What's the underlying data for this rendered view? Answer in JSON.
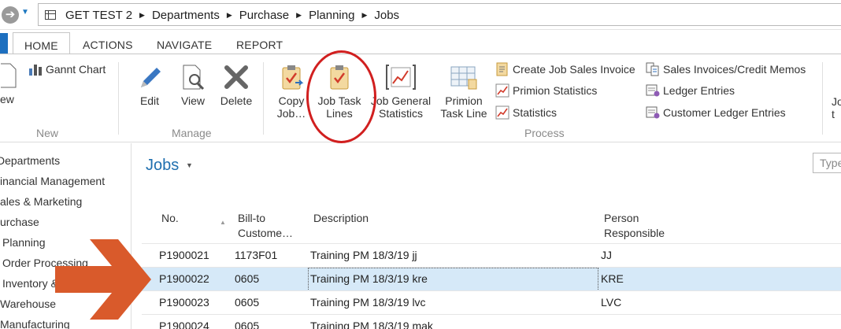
{
  "breadcrumb": [
    "GET TEST 2",
    "Departments",
    "Purchase",
    "Planning",
    "Jobs"
  ],
  "tabs": {
    "home": "HOME",
    "actions": "ACTIONS",
    "navigate": "NAVIGATE",
    "report": "REPORT"
  },
  "ribbon": {
    "new_partial": "ew",
    "gannt_chart": "Gannt Chart",
    "group_new": "New",
    "edit": "Edit",
    "view": "View",
    "delete": "Delete",
    "group_manage": "Manage",
    "copy_job_l1": "Copy",
    "copy_job_l2": "Job…",
    "job_task_l1": "Job Task",
    "job_task_l2": "Lines",
    "job_general_l1": "Job General",
    "job_general_l2": "Statistics",
    "primion_task_l1": "Primion",
    "primion_task_l2": "Task Line",
    "create_invoice": "Create Job Sales Invoice",
    "primion_statistics": "Primion Statistics",
    "statistics": "Statistics",
    "sales_invoices": "Sales Invoices/Credit Memos",
    "ledger_entries": "Ledger Entries",
    "customer_ledger": "Customer Ledger Entries",
    "group_process": "Process",
    "cut_l1": "Jo",
    "cut_l2": "t"
  },
  "nav": [
    "Departments",
    "inancial Management",
    "ales & Marketing",
    "urchase",
    "Planning",
    "Order Processing",
    "Inventory & Costing",
    "Warehouse",
    "Manufacturing"
  ],
  "page": {
    "title": "Jobs",
    "search_placeholder": "Type"
  },
  "columns": {
    "no": "No.",
    "bill_to_1": "Bill-to",
    "bill_to_2": "Custome…",
    "description": "Description",
    "person_1": "Person",
    "person_2": "Responsible"
  },
  "rows": [
    {
      "no": "P1900021",
      "bill_to": "1173F01",
      "description": "Training PM 18/3/19 jj",
      "person": "JJ"
    },
    {
      "no": "P1900022",
      "bill_to": "0605",
      "description": "Training PM 18/3/19 kre",
      "person": "KRE"
    },
    {
      "no": "P1900023",
      "bill_to": "0605",
      "description": "Training PM 18/3/19 lvc",
      "person": "LVC"
    },
    {
      "no": "P1900024",
      "bill_to": "0605",
      "description": "Training PM 18/3/19 mak",
      "person": ""
    }
  ],
  "selected_row": "P1900022",
  "colors": {
    "accent": "#1f6faf",
    "selected": "#d6e9f8",
    "annotation_red": "#d11f1f",
    "arrow_orange": "#d95a2b"
  }
}
